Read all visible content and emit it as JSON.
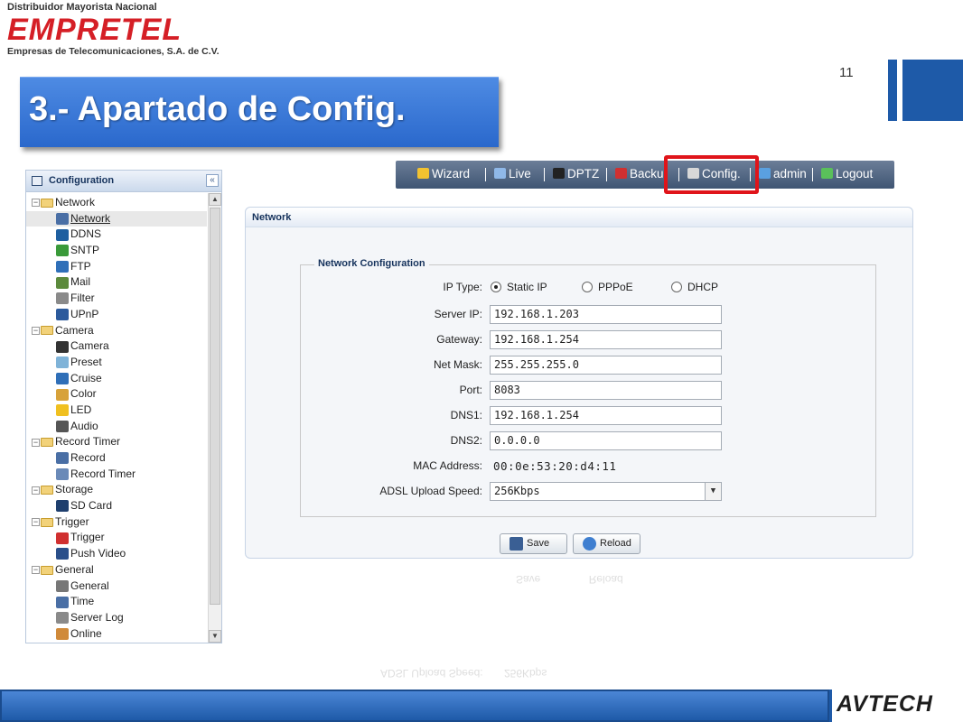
{
  "header": {
    "tagline": "Distribuidor Mayorista Nacional",
    "brand": "EMPRETEL",
    "subtitle": "Empresas de Telecomunicaciones, S.A. de C.V.",
    "page_number": "11",
    "slide_title": "3.- Apartado de Config."
  },
  "tree": {
    "title": "Configuration",
    "collapse_glyph": "«",
    "groups": [
      {
        "label": "Network",
        "items": [
          {
            "label": "Network",
            "icon": "network-icon",
            "color": "#4a6fa5",
            "selected": true
          },
          {
            "label": "DDNS",
            "icon": "ddns-icon",
            "color": "#1f5fa0"
          },
          {
            "label": "SNTP",
            "icon": "sntp-icon",
            "color": "#3a9a3a"
          },
          {
            "label": "FTP",
            "icon": "ftp-icon",
            "color": "#2f6fb8"
          },
          {
            "label": "Mail",
            "icon": "mail-icon",
            "color": "#5c8a3c"
          },
          {
            "label": "Filter",
            "icon": "filter-icon",
            "color": "#8a8a8a"
          },
          {
            "label": "UPnP",
            "icon": "upnp-icon",
            "color": "#2c5a9c"
          }
        ]
      },
      {
        "label": "Camera",
        "items": [
          {
            "label": "Camera",
            "icon": "camera-icon",
            "color": "#333333"
          },
          {
            "label": "Preset",
            "icon": "preset-icon",
            "color": "#7fb3d8"
          },
          {
            "label": "Cruise",
            "icon": "cruise-icon",
            "color": "#2f6fb8"
          },
          {
            "label": "Color",
            "icon": "color-icon",
            "color": "#d7a23a"
          },
          {
            "label": "LED",
            "icon": "led-icon",
            "color": "#f0c020"
          },
          {
            "label": "Audio",
            "icon": "audio-icon",
            "color": "#555555"
          }
        ]
      },
      {
        "label": "Record Timer",
        "items": [
          {
            "label": "Record",
            "icon": "record-icon",
            "color": "#4a6fa5"
          },
          {
            "label": "Record Timer",
            "icon": "record-timer-icon",
            "color": "#6a8ab8"
          }
        ]
      },
      {
        "label": "Storage",
        "items": [
          {
            "label": "SD Card",
            "icon": "sd-card-icon",
            "color": "#1f3f6e"
          }
        ]
      },
      {
        "label": "Trigger",
        "items": [
          {
            "label": "Trigger",
            "icon": "trigger-icon",
            "color": "#d03030"
          },
          {
            "label": "Push Video",
            "icon": "push-video-icon",
            "color": "#2a4f8a"
          }
        ]
      },
      {
        "label": "General",
        "items": [
          {
            "label": "General",
            "icon": "general-icon",
            "color": "#777777"
          },
          {
            "label": "Time",
            "icon": "time-icon",
            "color": "#4a6fa5"
          },
          {
            "label": "Server Log",
            "icon": "server-log-icon",
            "color": "#8a8a8a"
          },
          {
            "label": "Online",
            "icon": "online-icon",
            "color": "#d08a3a"
          }
        ]
      }
    ]
  },
  "nav": {
    "items": [
      {
        "label": "Wizard",
        "icon": "wizard-icon",
        "color": "#f2c230"
      },
      {
        "label": "Live",
        "icon": "live-icon",
        "color": "#8fb8e8"
      },
      {
        "label": "DPTZ",
        "icon": "dptz-icon",
        "color": "#222222"
      },
      {
        "label": "Backu",
        "icon": "backup-icon",
        "color": "#d03030"
      },
      {
        "label": "Config.",
        "icon": "config-icon",
        "color": "#d8d8d8"
      },
      {
        "label": "admin",
        "icon": "admin-icon",
        "color": "#5aa0e0"
      },
      {
        "label": "Logout",
        "icon": "logout-icon",
        "color": "#5ac05a"
      }
    ]
  },
  "network": {
    "panel_title": "Network",
    "fieldset_title": "Network Configuration",
    "ip_type_label": "IP Type:",
    "ip_type_options": [
      {
        "label": "Static IP",
        "selected": true
      },
      {
        "label": "PPPoE",
        "selected": false
      },
      {
        "label": "DHCP",
        "selected": false
      }
    ],
    "fields": [
      {
        "label": "Server IP:",
        "value": "192.168.1.203"
      },
      {
        "label": "Gateway:",
        "value": "192.168.1.254"
      },
      {
        "label": "Net Mask:",
        "value": "255.255.255.0"
      },
      {
        "label": "Port:",
        "value": "8083"
      },
      {
        "label": "DNS1:",
        "value": "192.168.1.254"
      },
      {
        "label": "DNS2:",
        "value": "0.0.0.0"
      }
    ],
    "mac_label": "MAC Address:",
    "mac_value": "00:0e:53:20:d4:11",
    "adsl_label": "ADSL Upload Speed:",
    "adsl_value": "256Kbps",
    "save_label": "Save",
    "reload_label": "Reload"
  },
  "footer": {
    "logo": "AVTECH"
  }
}
